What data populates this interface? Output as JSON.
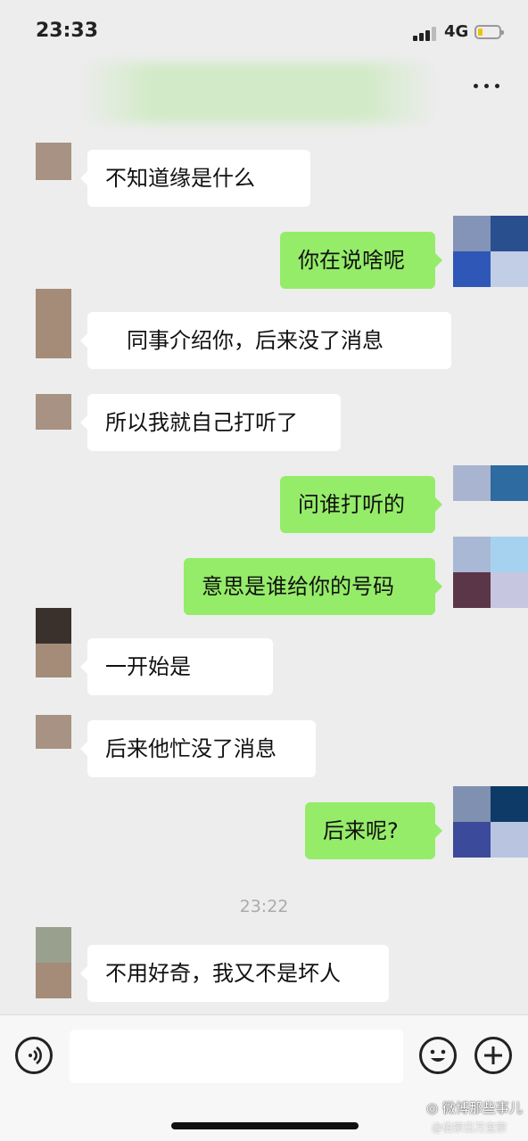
{
  "status_bar": {
    "time": "23:33",
    "network": "4G"
  },
  "nav": {
    "title": "···"
  },
  "messages": [
    {
      "side": "in",
      "text": "不知道缘是什么"
    },
    {
      "side": "out",
      "text": "你在说啥呢"
    },
    {
      "side": "in",
      "text": "同事介绍你，后来没了消息"
    },
    {
      "side": "in",
      "text": "所以我就自己打听了"
    },
    {
      "side": "out",
      "text": "问谁打听的"
    },
    {
      "side": "out",
      "text": "意思是谁给你的号码"
    },
    {
      "side": "in",
      "text": "一开始是"
    },
    {
      "side": "in",
      "text": "后来他忙没了消息"
    },
    {
      "side": "out",
      "text": "后来呢?"
    },
    {
      "side": "in",
      "text": "不用好奇，我又不是坏人"
    }
  ],
  "time_divider": "23:22",
  "input": {
    "value": ""
  },
  "icons": {
    "voice": "voice-icon",
    "emoji": "emoji-icon",
    "more": "more-icon",
    "add": "plus-icon"
  },
  "colors": {
    "outgoing_bubble": "#95ec69",
    "incoming_bubble": "#ffffff",
    "background": "#ededed"
  },
  "watermark": {
    "line1": "微博那些事儿",
    "line2": "@伯宗日万宝宗"
  }
}
